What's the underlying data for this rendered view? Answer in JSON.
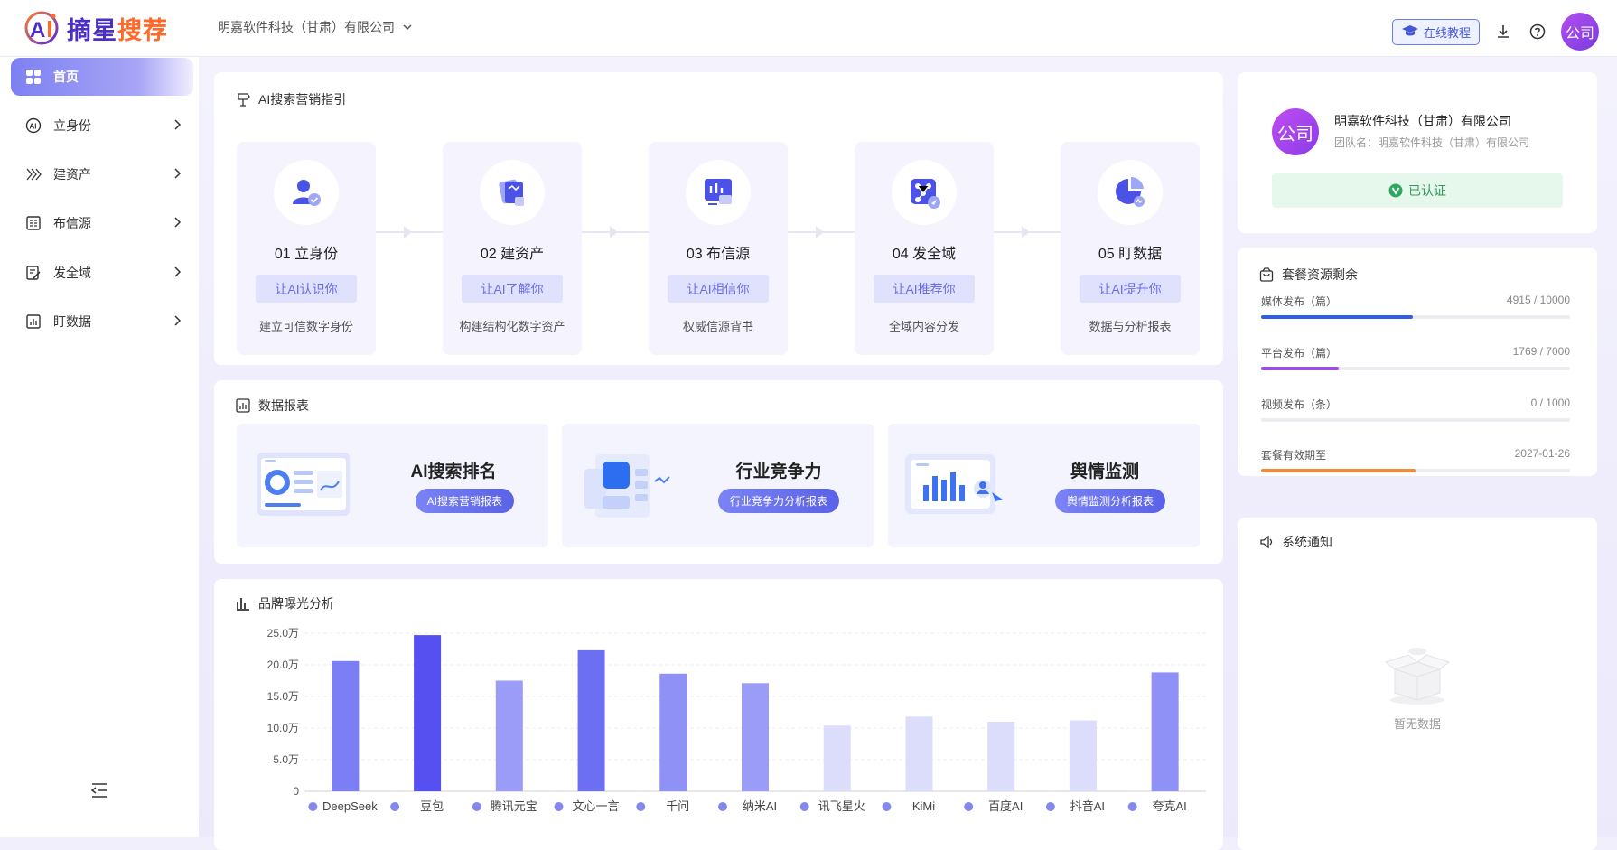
{
  "app": {
    "logo_main": "摘星",
    "logo_accent": "搜荐"
  },
  "header": {
    "company": "明嘉软件科技（甘肃）有限公司",
    "tutorial": "在线教程",
    "avatar": "公司"
  },
  "sidebar": {
    "items": [
      {
        "label": "首页",
        "icon": "grid-icon"
      },
      {
        "label": "立身份",
        "icon": "ai-badge-icon"
      },
      {
        "label": "建资产",
        "icon": "layers-icon"
      },
      {
        "label": "布信源",
        "icon": "source-icon"
      },
      {
        "label": "发全域",
        "icon": "publish-icon"
      },
      {
        "label": "盯数据",
        "icon": "chart-icon"
      }
    ]
  },
  "guide": {
    "title": "AI搜索营销指引",
    "steps": [
      {
        "title": "01 立身份",
        "tag": "让AI认识你",
        "desc": "建立可信数字身份"
      },
      {
        "title": "02 建资产",
        "tag": "让AI了解你",
        "desc": "构建结构化数字资产"
      },
      {
        "title": "03 布信源",
        "tag": "让AI相信你",
        "desc": "权威信源背书"
      },
      {
        "title": "04 发全域",
        "tag": "让AI推荐你",
        "desc": "全域内容分发"
      },
      {
        "title": "05 盯数据",
        "tag": "让AI提升你",
        "desc": "数据与分析报表"
      }
    ]
  },
  "reports": {
    "title": "数据报表",
    "items": [
      {
        "title": "AI搜索排名",
        "button": "AI搜索营销报表"
      },
      {
        "title": "行业竞争力",
        "button": "行业竞争力分析报表"
      },
      {
        "title": "舆情监测",
        "button": "舆情监测分析报表"
      }
    ]
  },
  "brand": {
    "title": "品牌曝光分析"
  },
  "chart_data": {
    "type": "bar",
    "categories": [
      "DeepSeek",
      "豆包",
      "腾讯元宝",
      "文心一言",
      "千问",
      "纳米AI",
      "讯飞星火",
      "KiMi",
      "百度AI",
      "抖音AI",
      "夸克AI"
    ],
    "values": [
      20.6,
      24.7,
      17.5,
      22.3,
      18.6,
      17.1,
      10.4,
      11.8,
      11.0,
      11.2,
      18.8
    ],
    "colors": [
      "#7b7ef4",
      "#5650f0",
      "#9a9cf7",
      "#6d6ff2",
      "#8f91f6",
      "#9a9cf7",
      "#dcdcfb",
      "#dcdcfb",
      "#dcdcfb",
      "#dcdcfb",
      "#8f91f6"
    ],
    "yticks": [
      "0",
      "5.0万",
      "10.0万",
      "15.0万",
      "20.0万",
      "25.0万"
    ],
    "ylim": [
      0,
      25
    ],
    "grid": true
  },
  "company_card": {
    "avatar": "公司",
    "name": "明嘉软件科技（甘肃）有限公司",
    "team": "团队名：明嘉软件科技（甘肃）有限公司",
    "verified": "已认证"
  },
  "resources": {
    "title": "套餐资源剩余",
    "items": [
      {
        "label": "媒体发布（篇）",
        "value": "4915 / 10000",
        "ratio": 0.4915,
        "color": "#2f5ee8"
      },
      {
        "label": "平台发布（篇）",
        "value": "1769 / 7000",
        "ratio": 0.2527,
        "color": "#9b4fe6"
      },
      {
        "label": "视频发布（条）",
        "value": "0 / 1000",
        "ratio": 0,
        "color": "#2f5ee8"
      },
      {
        "label": "套餐有效期至",
        "value": "2027-01-26",
        "ratio": 0.5,
        "color": "#f28a3c"
      }
    ]
  },
  "notice": {
    "title": "系统通知",
    "empty": "暂无数据"
  }
}
